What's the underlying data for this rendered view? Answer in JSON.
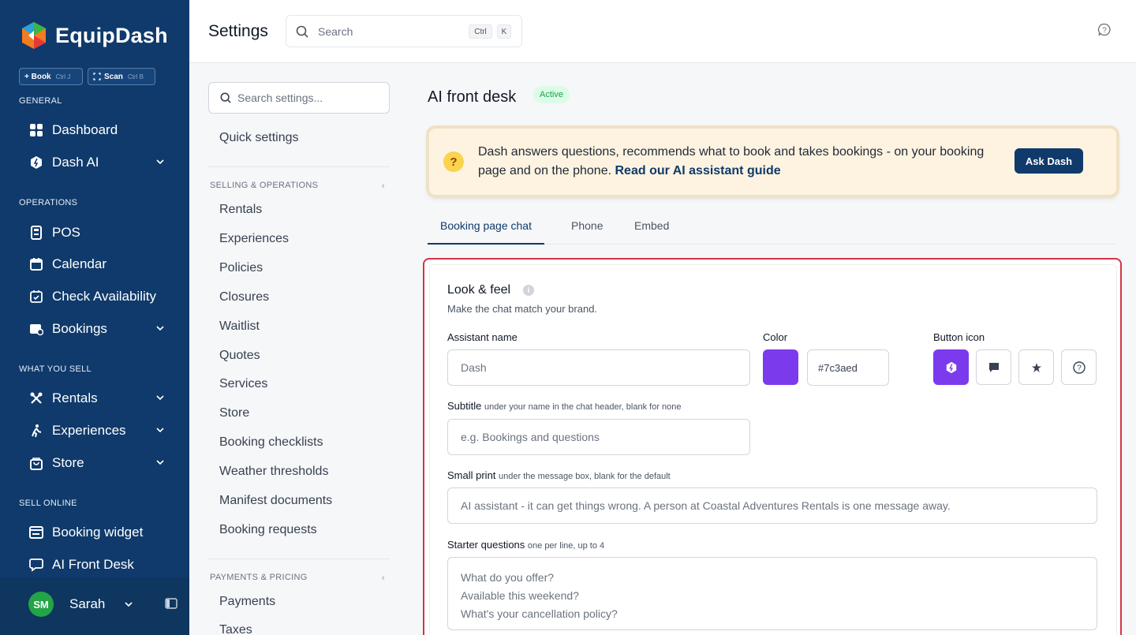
{
  "app": {
    "name": "EquipDash"
  },
  "quick_actions": [
    {
      "label": "+ Book",
      "shortcut": "Ctrl J"
    },
    {
      "label": "Scan",
      "shortcut": "Ctrl B"
    }
  ],
  "sidebar": {
    "sections": {
      "general": "GENERAL",
      "operations": "OPERATIONS",
      "what_you_sell": "WHAT YOU SELL",
      "sell_online": "SELL ONLINE"
    },
    "items": {
      "dashboard": "Dashboard",
      "dash_ai": "Dash AI",
      "pos": "POS",
      "calendar": "Calendar",
      "check_availability": "Check Availability",
      "bookings": "Bookings",
      "rentals": "Rentals",
      "experiences": "Experiences",
      "store": "Store",
      "booking_widget": "Booking widget",
      "ai_front_desk": "AI Front Desk"
    },
    "user": {
      "initials": "SM",
      "name": "Sarah"
    }
  },
  "header": {
    "title": "Settings",
    "search_placeholder": "Search",
    "kbd1": "Ctrl",
    "kbd2": "K"
  },
  "settings_nav": {
    "search_placeholder": "Search settings...",
    "quick": "Quick settings",
    "section1": "SELLING & OPERATIONS",
    "items1": [
      "Rentals",
      "Experiences",
      "Policies",
      "Closures",
      "Waitlist",
      "Quotes",
      "Services",
      "Store",
      "Booking checklists",
      "Weather thresholds",
      "Manifest documents",
      "Booking requests"
    ],
    "section2": "PAYMENTS & PRICING",
    "items2": [
      "Payments",
      "Taxes"
    ]
  },
  "page": {
    "title": "AI front desk",
    "status": "Active",
    "banner": {
      "text": "Dash answers questions, recommends what to book and takes bookings - on your booking page and on the phone. ",
      "link": "Read our AI assistant guide",
      "button": "Ask Dash"
    },
    "tabs": [
      "Booking page chat",
      "Phone",
      "Embed"
    ],
    "look": {
      "title": "Look & feel",
      "subtitle": "Make the chat match your brand.",
      "assistant_label": "Assistant name",
      "assistant_placeholder": "Dash",
      "color_label": "Color",
      "color_value": "#7c3aed",
      "button_icon_label": "Button icon",
      "subtitle_label": "Subtitle",
      "subtitle_hint": "under your name in the chat header, blank for none",
      "subtitle_placeholder": "e.g. Bookings and questions",
      "smallprint_label": "Small print",
      "smallprint_hint": "under the message box, blank for the default",
      "smallprint_placeholder": "AI assistant - it can get things wrong. A person at Coastal Adventures Rentals is one message away.",
      "starter_label": "Starter questions",
      "starter_hint": "one per line, up to 4",
      "starter_lines": [
        "What do you offer?",
        "Available this weekend?",
        "What's your cancellation policy?"
      ]
    }
  },
  "colors": {
    "sidebar": "#0f3a6b",
    "accent": "#7c3aed",
    "highlight": "#d33448",
    "banner": "#fdf3e0"
  }
}
